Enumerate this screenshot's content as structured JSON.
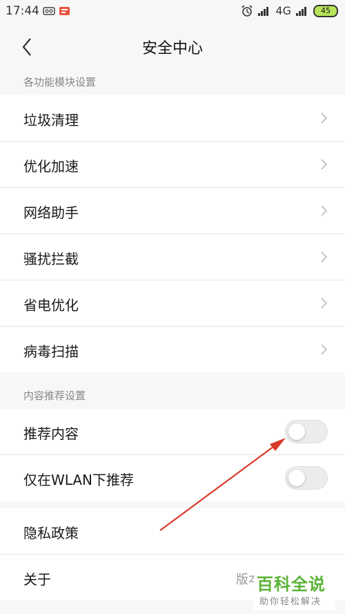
{
  "status_bar": {
    "time": "17:44",
    "network": "4G",
    "battery": "45"
  },
  "header": {
    "title": "安全中心"
  },
  "section1": {
    "label": "各功能模块设置",
    "items": [
      {
        "label": "垃圾清理"
      },
      {
        "label": "优化加速"
      },
      {
        "label": "网络助手"
      },
      {
        "label": "骚扰拦截"
      },
      {
        "label": "省电优化"
      },
      {
        "label": "病毒扫描"
      }
    ]
  },
  "section2": {
    "label": "内容推荐设置",
    "items": [
      {
        "label": "推荐内容",
        "on": false
      },
      {
        "label": "仅在WLAN下推荐",
        "on": false
      }
    ]
  },
  "section3": {
    "items": [
      {
        "label": "隐私政策"
      },
      {
        "label": "关于",
        "value": "版本"
      }
    ]
  },
  "watermark": {
    "title": "百科全说",
    "subtitle": "助你轻松解决"
  },
  "colors": {
    "annotation_arrow": "#d93a2b",
    "watermark_green": "#5bb336",
    "battery_green": "#b7e45a"
  }
}
